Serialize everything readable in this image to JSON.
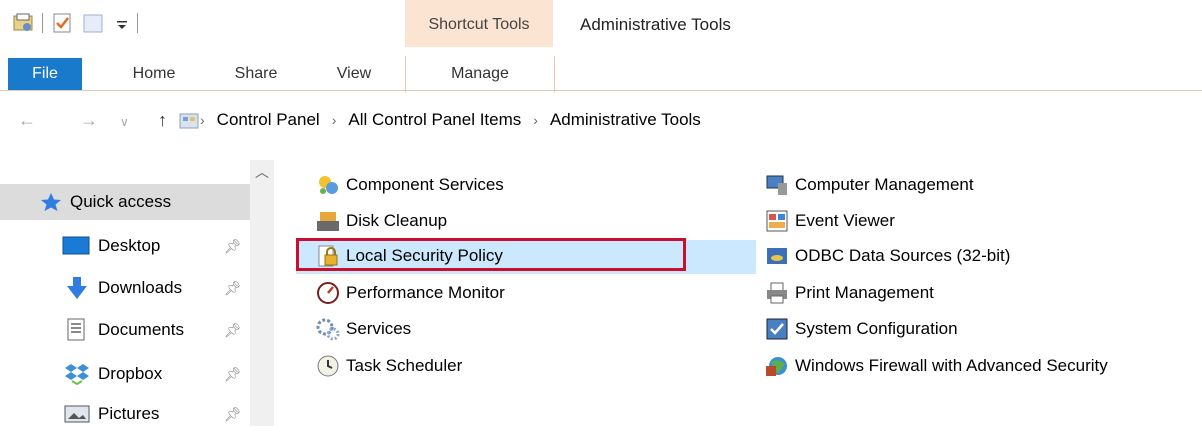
{
  "window": {
    "title": "Administrative Tools",
    "context_tab_group": "Shortcut Tools"
  },
  "ribbon": {
    "tabs": [
      {
        "label": "File"
      },
      {
        "label": "Home"
      },
      {
        "label": "Share"
      },
      {
        "label": "View"
      },
      {
        "label": "Manage"
      }
    ]
  },
  "address_bar": {
    "breadcrumbs": [
      "Control Panel",
      "All Control Panel Items",
      "Administrative Tools"
    ],
    "separator": "›"
  },
  "nav_pane": {
    "quick_access": "Quick access",
    "items": [
      {
        "label": "Desktop",
        "icon": "desktop-icon"
      },
      {
        "label": "Downloads",
        "icon": "downloads-icon"
      },
      {
        "label": "Documents",
        "icon": "documents-icon"
      },
      {
        "label": "Dropbox",
        "icon": "dropbox-icon"
      },
      {
        "label": "Pictures",
        "icon": "pictures-icon"
      }
    ]
  },
  "files": {
    "left_column": [
      {
        "label": "Component Services",
        "icon": "component-services-icon"
      },
      {
        "label": "Disk Cleanup",
        "icon": "disk-cleanup-icon"
      },
      {
        "label": "Local Security Policy",
        "icon": "local-security-policy-icon",
        "selected": true
      },
      {
        "label": "Performance Monitor",
        "icon": "performance-monitor-icon"
      },
      {
        "label": "Services",
        "icon": "services-icon"
      },
      {
        "label": "Task Scheduler",
        "icon": "task-scheduler-icon"
      }
    ],
    "right_column": [
      {
        "label": "Computer Management",
        "icon": "computer-management-icon"
      },
      {
        "label": "Event Viewer",
        "icon": "event-viewer-icon"
      },
      {
        "label": "ODBC Data Sources (32-bit)",
        "icon": "odbc-icon"
      },
      {
        "label": "Print Management",
        "icon": "print-management-icon"
      },
      {
        "label": "System Configuration",
        "icon": "system-configuration-icon"
      },
      {
        "label": "Windows Firewall with Advanced Security",
        "icon": "firewall-icon"
      }
    ]
  },
  "colors": {
    "file_tab": "#1979ca",
    "context_tab": "#fce4d3",
    "selection": "#cce8ff",
    "highlight_box": "#c8102e"
  }
}
